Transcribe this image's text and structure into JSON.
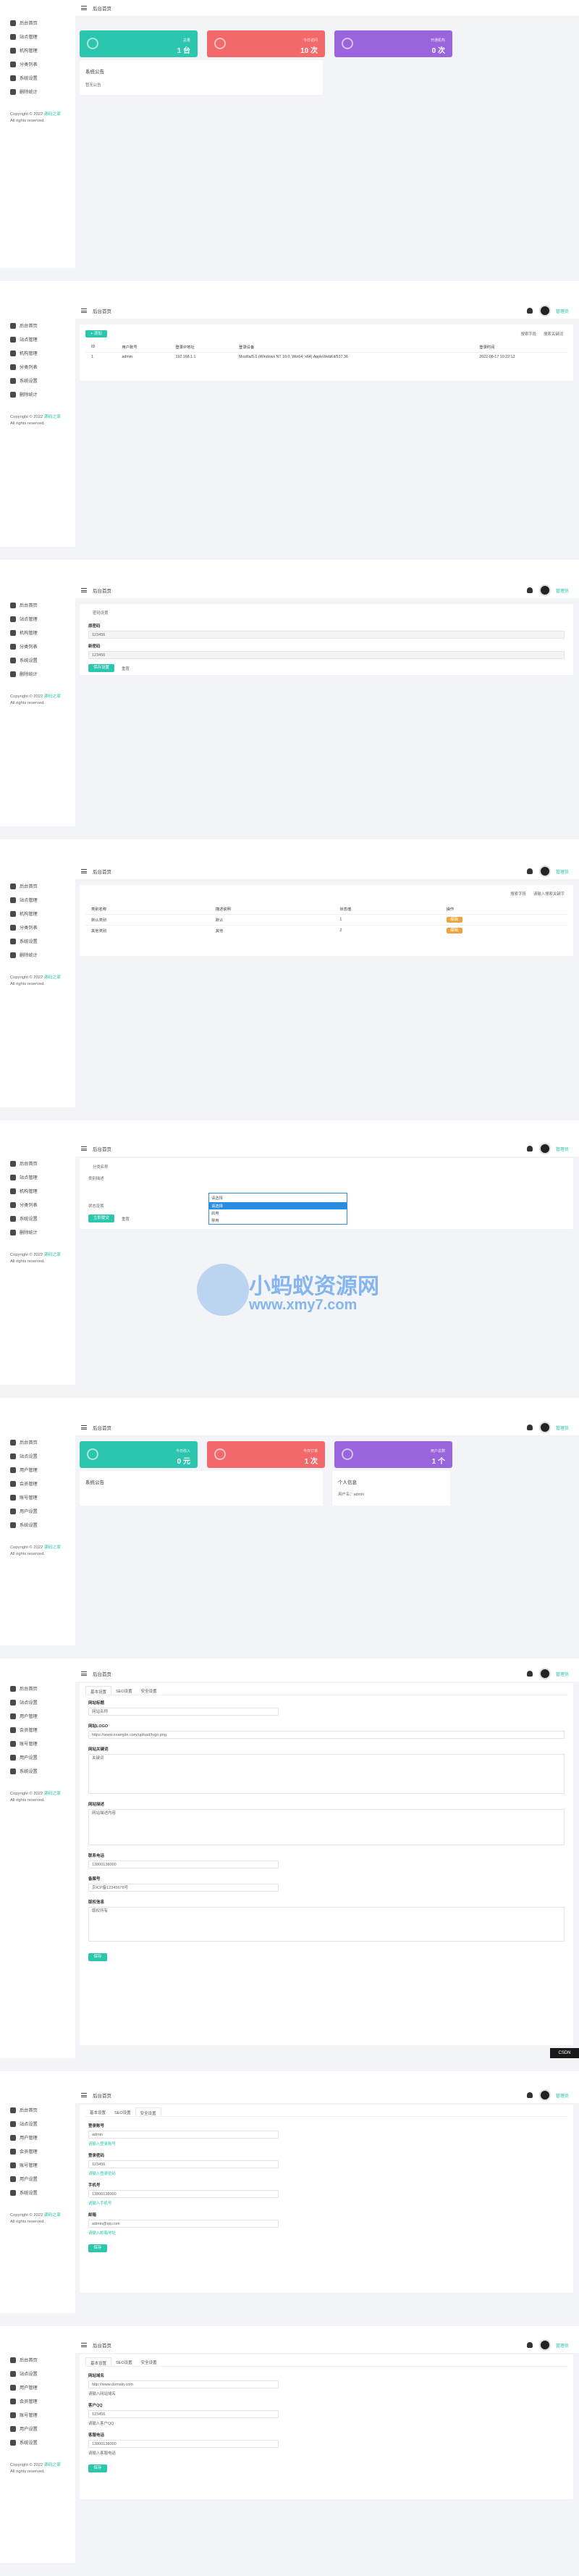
{
  "common": {
    "home": "后台首页",
    "user": "管理员",
    "copyright": "Copyright © 2022",
    "copyright_link": "源码之家",
    "rights": "All rights reserved.",
    "nav_admin": [
      "后台首页",
      "站点管理",
      "机构管理",
      "分类列表",
      "系统设置",
      "删除统计"
    ],
    "nav_user": [
      "后台首页",
      "站点设置",
      "用户管理",
      "会员管理",
      "账号管理",
      "用户设置",
      "系统设置"
    ]
  },
  "shot1": {
    "cards": [
      {
        "label": "总量",
        "value": "1 台"
      },
      {
        "label": "今日访问",
        "value": "10 次"
      },
      {
        "label": "开通机构",
        "value": "0 次"
      }
    ],
    "notice_title": "系统公告",
    "notice_text": "暂无公告"
  },
  "shot2": {
    "add_btn": "+ 添加",
    "search_ph": "搜索字段",
    "search_ph2": "搜索关键词",
    "headers": [
      "ID",
      "用户账号",
      "登录IP地址",
      "登录设备",
      "登录时间"
    ],
    "rows": [
      [
        "1",
        "admin",
        "192.168.1.1",
        "Mozilla/5.0 (Windows NT 10.0; Win64; x64) AppleWebKit/537.36",
        "2022-08-17 10:22:12"
      ]
    ]
  },
  "shot3": {
    "section": "密码设置",
    "f1": "原密码",
    "v1": "123456",
    "f2": "新密码",
    "v2": "123456",
    "save": "保存设置",
    "reset": "重置"
  },
  "shot4": {
    "search_ph": "搜索字段",
    "search_ph2": "请输入搜索关键字",
    "headers": [
      "类别名称",
      "描述说明",
      "状态值",
      "操作"
    ],
    "rows": [
      [
        "默认类别",
        "默认",
        "1",
        "编辑"
      ],
      [
        "其他类别",
        "其他",
        "2",
        "编辑"
      ]
    ]
  },
  "shot5": {
    "f1": "分类名称",
    "f2": "类别描述",
    "f3": "状态设置",
    "select_value": "请选择",
    "options": [
      "请选择",
      "启用",
      "禁用"
    ],
    "save": "立即提交",
    "reset": "重置"
  },
  "watermark": {
    "cn": "小蚂蚁资源网",
    "url": "www.xmy7.com"
  },
  "shot6": {
    "cards": [
      {
        "label": "今日收入",
        "value": "0 元"
      },
      {
        "label": "今日订单",
        "value": "1 次"
      },
      {
        "label": "用户总数",
        "value": "1 个"
      }
    ],
    "left_title": "系统公告",
    "right_title": "个人信息",
    "right_text": "用户名：admin"
  },
  "shot7": {
    "tabs": [
      "基本设置",
      "SEO设置",
      "安全设置"
    ],
    "fields": [
      {
        "label": "网站标题",
        "value": "网站名称"
      },
      {
        "label": "网站LOGO",
        "value": "https://www.example.com/upload/logo.png"
      },
      {
        "label": "网站关键词",
        "value": "关键词"
      },
      {
        "label": "网站描述",
        "value": "网站描述内容"
      },
      {
        "label": "联系电话",
        "value": "13800138000"
      },
      {
        "label": "备案号",
        "value": "京ICP备12345678号"
      },
      {
        "label": "版权信息",
        "value": "版权所有"
      }
    ],
    "save": "保存",
    "badge": "CSDN"
  },
  "shot8": {
    "tabs": [
      "基本设置",
      "SEO设置",
      "安全设置"
    ],
    "fields": [
      {
        "label": "登录账号",
        "value": "admin",
        "hint": "请输入登录账号"
      },
      {
        "label": "登录密码",
        "value": "123456",
        "hint": "请输入登录密码"
      },
      {
        "label": "手机号",
        "value": "13800138000",
        "hint": "请输入手机号"
      },
      {
        "label": "邮箱",
        "value": "admin@qq.com",
        "hint": "请输入邮箱地址"
      }
    ],
    "save": "保存"
  },
  "shot9": {
    "tabs": [
      "基本设置",
      "SEO设置",
      "安全设置"
    ],
    "fields": [
      {
        "label": "网站域名",
        "value": "http://www.domain.com",
        "hint": "请输入网站域名"
      },
      {
        "label": "客户QQ",
        "value": "123456",
        "hint": "请输入客户QQ"
      },
      {
        "label": "客服电话",
        "value": "13800138000",
        "hint": "请输入客服电话"
      }
    ],
    "save": "保存"
  }
}
